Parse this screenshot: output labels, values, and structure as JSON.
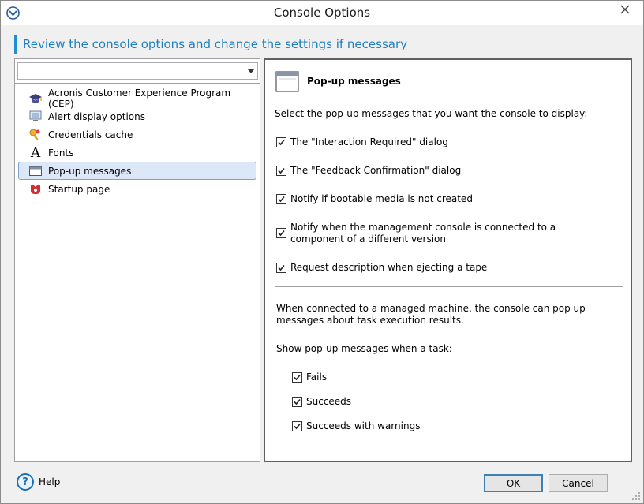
{
  "window": {
    "title": "Console Options"
  },
  "header": {
    "text": "Review the console options and change the settings if necessary"
  },
  "search": {
    "value": ""
  },
  "tree": {
    "items": [
      {
        "label": "Acronis Customer Experience Program (CEP)",
        "icon": "graduation-cap-icon"
      },
      {
        "label": "Alert display options",
        "icon": "monitor-alert-icon"
      },
      {
        "label": "Credentials cache",
        "icon": "keys-icon"
      },
      {
        "label": "Fonts",
        "icon": "font-icon"
      },
      {
        "label": "Pop-up messages",
        "icon": "window-icon",
        "selected": true
      },
      {
        "label": "Startup page",
        "icon": "startup-icon"
      }
    ]
  },
  "panel": {
    "title": "Pop-up messages",
    "intro": "Select the pop-up messages that you want the console to display:",
    "options": [
      {
        "label": "The \"Interaction Required\" dialog",
        "checked": true
      },
      {
        "label": "The \"Feedback Confirmation\" dialog",
        "checked": true
      },
      {
        "label": "Notify if bootable media is not created",
        "checked": true
      },
      {
        "label": "Notify when the management console is connected to a component of a different version",
        "checked": true
      },
      {
        "label": "Request description when ejecting a tape",
        "checked": true
      }
    ],
    "managed_text": "When connected to a managed machine, the console can pop up messages about task execution results.",
    "task_label": "Show pop-up messages when a task:",
    "task_options": [
      {
        "label": "Fails",
        "checked": true
      },
      {
        "label": "Succeeds",
        "checked": true
      },
      {
        "label": "Succeeds with warnings",
        "checked": true
      }
    ]
  },
  "footer": {
    "help_label": "Help",
    "ok_label": "OK",
    "cancel_label": "Cancel"
  },
  "colors": {
    "accent": "#1e8fd0",
    "header_text": "#1e7fc0",
    "selection": "#dce8f8"
  }
}
